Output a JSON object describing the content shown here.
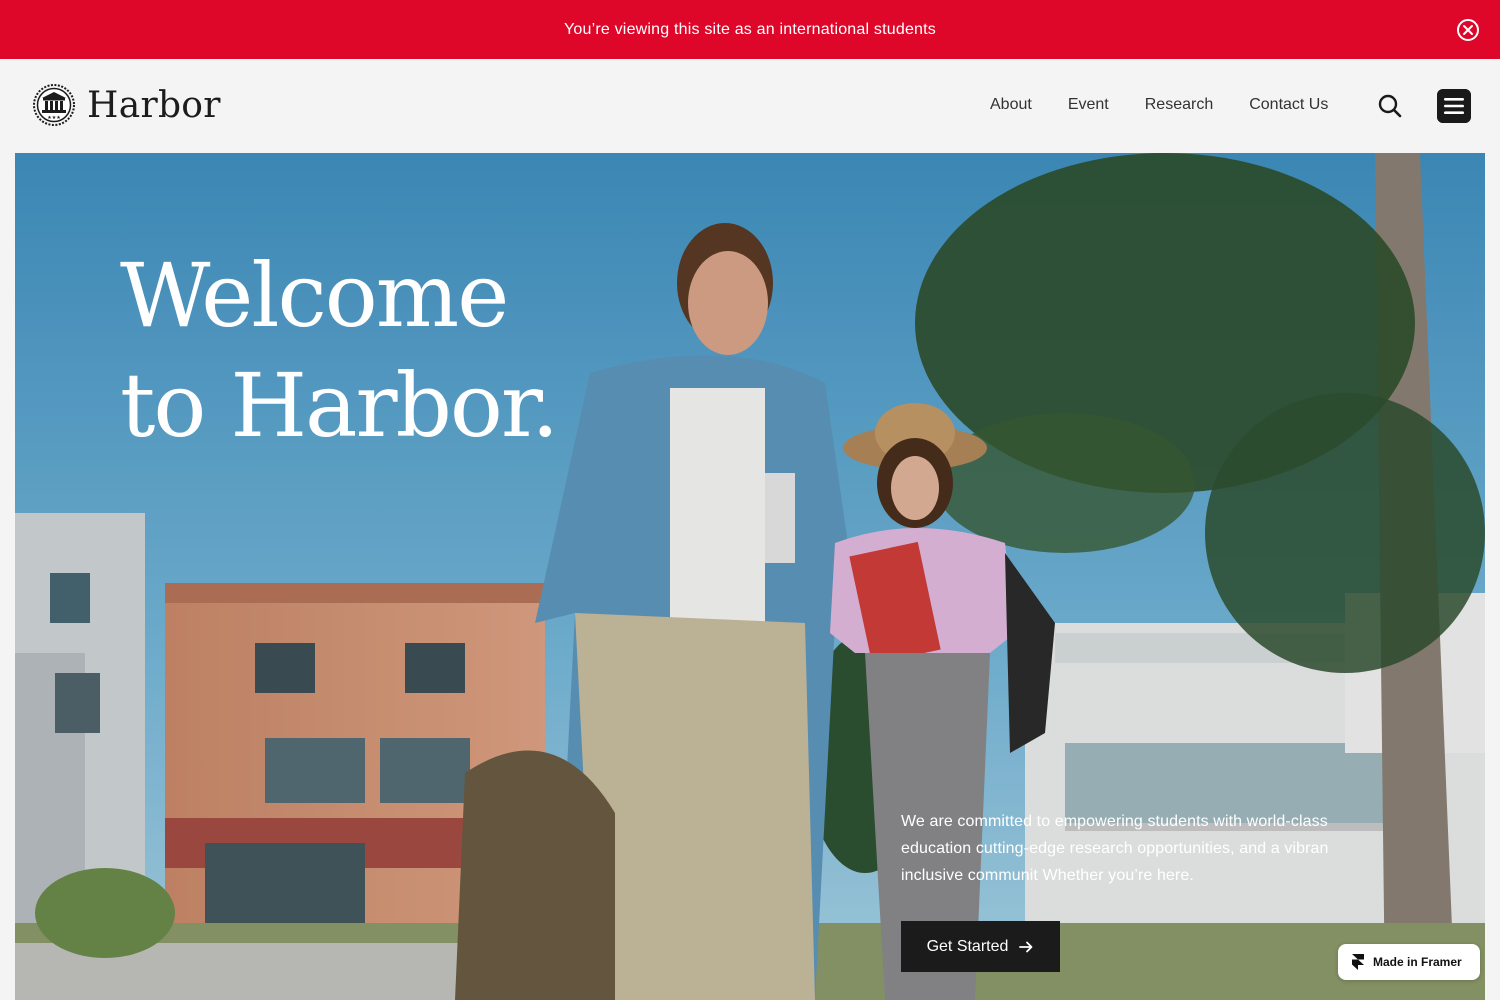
{
  "banner": {
    "text": "You’re viewing this site as an international students",
    "close_icon": "close-circle-icon",
    "background": "#df0729"
  },
  "navbar": {
    "logo_icon": "university-building-icon",
    "logo_text": "Harbor",
    "links": [
      {
        "label": "About"
      },
      {
        "label": "Event"
      },
      {
        "label": "Research"
      },
      {
        "label": "Contact Us"
      }
    ],
    "search_icon": "search-icon",
    "menu_icon": "hamburger-menu-icon"
  },
  "hero": {
    "title_line1": "Welcome",
    "title_line2": "to Harbor.",
    "description": "We are committed to empowering students with world-class education cutting-edge research opportunities, and a vibran inclusive communit Whether you’re here.",
    "cta_label": "Get Started",
    "cta_icon": "arrow-right-icon",
    "image": "two-students-walking-campus-photo"
  },
  "badge": {
    "label": "Made in Framer",
    "icon": "framer-logo-icon"
  }
}
